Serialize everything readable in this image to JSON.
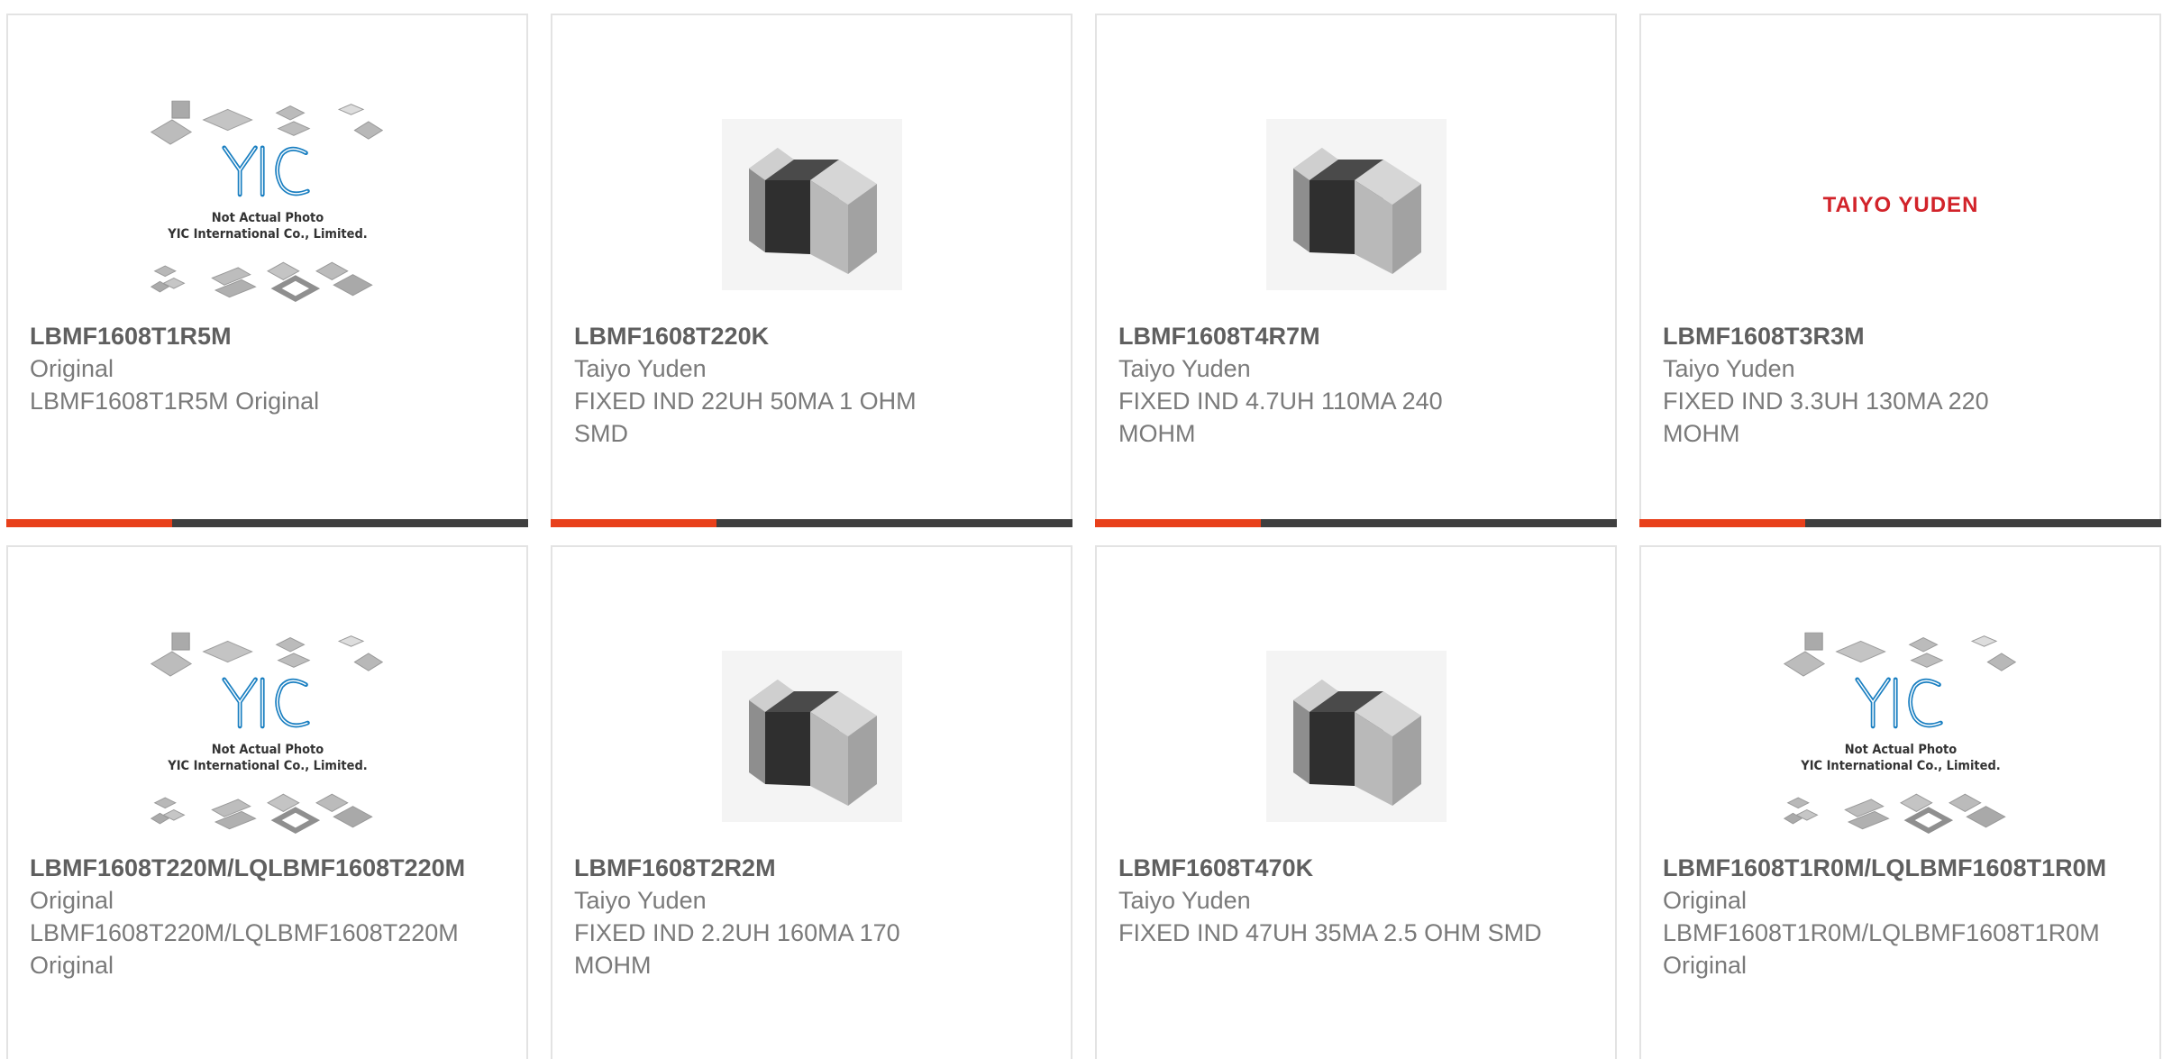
{
  "colors": {
    "accent": "#e8401b",
    "bar": "#3f3f3f",
    "border": "#e3e3e3",
    "text": "#7a7a7a",
    "brand_red": "#d2232a",
    "yic_blue": "#1a7fc1"
  },
  "products": [
    {
      "part": "LBMF1608T1R5M",
      "maker": "Original",
      "desc": "LBMF1608T1R5M Original",
      "image": "yic-placeholder-image",
      "placeholder_line1": "Not Actual Photo",
      "placeholder_line2": "YIC International Co., Limited."
    },
    {
      "part": "LBMF1608T220K",
      "maker": "Taiyo Yuden",
      "desc": "FIXED IND 22UH 50MA 1 OHM SMD",
      "image": "smd-chip-image"
    },
    {
      "part": "LBMF1608T4R7M",
      "maker": "Taiyo Yuden",
      "desc": "FIXED IND 4.7UH 110MA 240 MOHM",
      "image": "smd-chip-image"
    },
    {
      "part": "LBMF1608T3R3M",
      "maker": "Taiyo Yuden",
      "desc": "FIXED IND 3.3UH 130MA 220 MOHM",
      "image": "brand-logo-image",
      "logo_text": "TAIYO YUDEN"
    },
    {
      "part": "LBMF1608T220M/LQLBMF1608T220M",
      "maker": "Original",
      "desc": "LBMF1608T220M/LQLBMF1608T220M Original",
      "image": "yic-placeholder-image",
      "placeholder_line1": "Not Actual Photo",
      "placeholder_line2": "YIC International Co., Limited."
    },
    {
      "part": "LBMF1608T2R2M",
      "maker": "Taiyo Yuden",
      "desc": "FIXED IND 2.2UH 160MA 170 MOHM",
      "image": "smd-chip-image"
    },
    {
      "part": "LBMF1608T470K",
      "maker": "Taiyo Yuden",
      "desc": "FIXED IND 47UH 35MA 2.5 OHM SMD",
      "image": "smd-chip-image"
    },
    {
      "part": "LBMF1608T1R0M/LQLBMF1608T1R0M",
      "maker": "Original",
      "desc": "LBMF1608T1R0M/LQLBMF1608T1R0M Original",
      "image": "yic-placeholder-image",
      "placeholder_line1": "Not Actual Photo",
      "placeholder_line2": "YIC International Co., Limited."
    }
  ]
}
